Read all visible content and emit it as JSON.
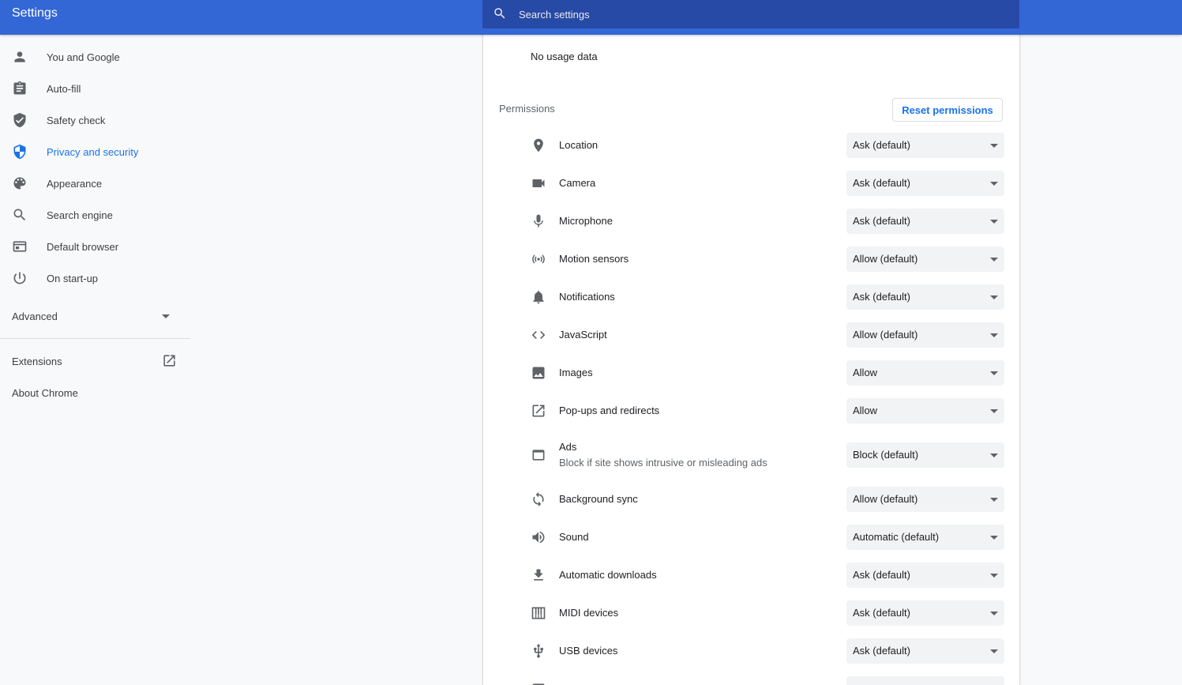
{
  "app": {
    "title": "Settings"
  },
  "search": {
    "placeholder": "Search settings"
  },
  "sidebar": {
    "items": [
      {
        "label": "You and Google",
        "icon": "person-icon"
      },
      {
        "label": "Auto-fill",
        "icon": "clipboard-icon"
      },
      {
        "label": "Safety check",
        "icon": "shield-check-icon"
      },
      {
        "label": "Privacy and security",
        "icon": "shield-icon",
        "active": true
      },
      {
        "label": "Appearance",
        "icon": "palette-icon"
      },
      {
        "label": "Search engine",
        "icon": "search-icon"
      },
      {
        "label": "Default browser",
        "icon": "browser-icon"
      },
      {
        "label": "On start-up",
        "icon": "power-icon"
      }
    ],
    "advanced_label": "Advanced",
    "extensions_label": "Extensions",
    "about_label": "About Chrome"
  },
  "main": {
    "usage_text": "No usage data",
    "permissions_heading": "Permissions",
    "reset_button": "Reset permissions",
    "permissions": [
      {
        "label": "Location",
        "value": "Ask (default)",
        "icon": "location-pin-icon"
      },
      {
        "label": "Camera",
        "value": "Ask (default)",
        "icon": "camera-icon"
      },
      {
        "label": "Microphone",
        "value": "Ask (default)",
        "icon": "microphone-icon"
      },
      {
        "label": "Motion sensors",
        "value": "Allow (default)",
        "icon": "sensors-icon"
      },
      {
        "label": "Notifications",
        "value": "Ask (default)",
        "icon": "bell-icon"
      },
      {
        "label": "JavaScript",
        "value": "Allow (default)",
        "icon": "code-icon"
      },
      {
        "label": "Images",
        "value": "Allow",
        "icon": "image-icon"
      },
      {
        "label": "Pop-ups and redirects",
        "value": "Allow",
        "icon": "open-in-new-icon"
      },
      {
        "label": "Ads",
        "sublabel": "Block if site shows intrusive or misleading ads",
        "value": "Block (default)",
        "icon": "ads-window-icon"
      },
      {
        "label": "Background sync",
        "value": "Allow (default)",
        "icon": "sync-icon"
      },
      {
        "label": "Sound",
        "value": "Automatic (default)",
        "icon": "speaker-icon"
      },
      {
        "label": "Automatic downloads",
        "value": "Ask (default)",
        "icon": "download-icon"
      },
      {
        "label": "MIDI devices",
        "value": "Ask (default)",
        "icon": "piano-icon"
      },
      {
        "label": "USB devices",
        "value": "Ask (default)",
        "icon": "usb-icon"
      }
    ]
  },
  "colors": {
    "header": "#3367d6",
    "search_bg": "#274aa6",
    "accent": "#1a73e8",
    "icon": "#5f6368"
  }
}
